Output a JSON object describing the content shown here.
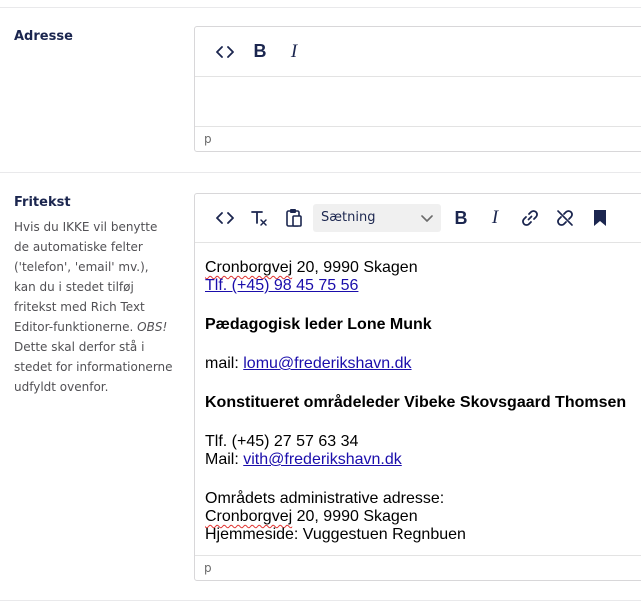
{
  "adresse": {
    "label": "Adresse",
    "toolbar": {
      "code_icon": "code-icon",
      "bold_icon": "bold-icon",
      "italic_icon": "italic-icon"
    },
    "status_path": "p"
  },
  "fritekst": {
    "label": "Fritekst",
    "description_parts": [
      "Hvis du IKKE vil benytte de automatiske felter ('telefon', 'email' mv.), kan du i stedet tilføj fritekst med Rich Text Editor-funktionerne. ",
      "OBS!",
      " Dette skal derfor stå i stedet for informationerne udfyldt ovenfor."
    ],
    "toolbar": {
      "block_format": "Sætning",
      "icons": [
        "code-icon",
        "remove-format-icon",
        "paste-icon",
        "bold-icon",
        "italic-icon",
        "link-icon",
        "unlink-icon",
        "bookmark-icon"
      ]
    },
    "content": {
      "address_street": "Cronborgvej",
      "address_rest": " 20, 9990 Skagen",
      "phone_link": "Tlf. (+45) 98 45 75 56",
      "leader_heading": "Pædagogisk leder Lone Munk",
      "mail_label": "mail: ",
      "mail_link": "lomu@frederikshavn.dk",
      "acting_heading": "Konstitueret områdeleder Vibeke Skovsgaard Thomsen",
      "phone2": "Tlf. (+45) 27 57 63 34",
      "mail2_label": "Mail: ",
      "mail2_link": "vith@frederikshavn.dk",
      "admin_label": "Områdets administrative adresse:",
      "admin_street": "Cronborgvej",
      "admin_rest": " 20, 9990 Skagen",
      "homepage": "Hjemmeside: Vuggestuen Regnbuen"
    },
    "status_path": "p"
  }
}
